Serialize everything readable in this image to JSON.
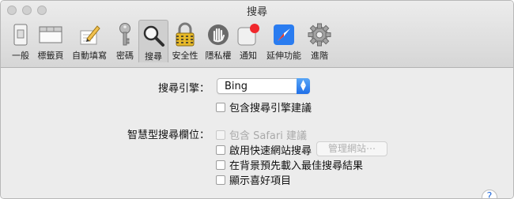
{
  "window": {
    "title": "搜尋"
  },
  "toolbar": {
    "tabs": [
      {
        "label": "一般",
        "icon": "general-switch-icon"
      },
      {
        "label": "標籤頁",
        "icon": "tabs-window-icon"
      },
      {
        "label": "自動填寫",
        "icon": "autofill-pencil-icon"
      },
      {
        "label": "密碼",
        "icon": "key-icon"
      },
      {
        "label": "搜尋",
        "icon": "magnifier-icon",
        "selected": true
      },
      {
        "label": "安全性",
        "icon": "padlock-icon"
      },
      {
        "label": "隱私權",
        "icon": "hand-icon"
      },
      {
        "label": "通知",
        "icon": "notification-badge-icon"
      },
      {
        "label": "延伸功能",
        "icon": "extensions-compass-icon"
      },
      {
        "label": "進階",
        "icon": "gear-icon"
      }
    ]
  },
  "search": {
    "engine_label": "搜尋引擎：",
    "engine_value": "Bing",
    "include_suggestions": "包含搜尋引擎建議"
  },
  "smart_search": {
    "label": "智慧型搜尋欄位：",
    "options": [
      {
        "text": "包含 Safari 建議",
        "disabled": true
      },
      {
        "text": "啟用快速網站搜尋",
        "disabled": false
      },
      {
        "text": "在背景預先載入最佳搜尋結果",
        "disabled": false
      },
      {
        "text": "顯示喜好項目",
        "disabled": false
      }
    ],
    "manage_sites_button": "管理網站⋯"
  },
  "help": {
    "label": "?"
  },
  "colors": {
    "accent": "#2a7cf0",
    "selected_tab_bg": "#cfcfcf",
    "window_bg": "#ececec"
  }
}
